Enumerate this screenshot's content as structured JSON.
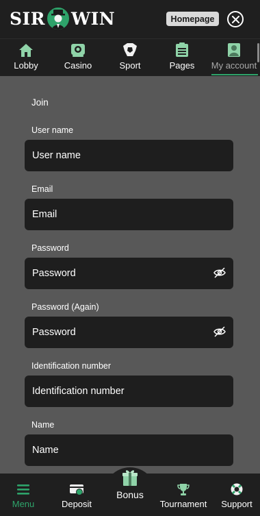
{
  "header": {
    "logo_left": "SIR",
    "logo_right": "WIN",
    "homepage_label": "Homepage"
  },
  "top_nav": [
    {
      "label": "Lobby",
      "icon": "home-icon"
    },
    {
      "label": "Casino",
      "icon": "casino-chip-icon"
    },
    {
      "label": "Sport",
      "icon": "soccer-ball-icon"
    },
    {
      "label": "Pages",
      "icon": "pages-list-icon"
    },
    {
      "label": "My account",
      "icon": "user-icon",
      "active": true
    }
  ],
  "form": {
    "title": "Join",
    "fields": [
      {
        "label": "User name",
        "placeholder": "User name"
      },
      {
        "label": "Email",
        "placeholder": "Email"
      },
      {
        "label": "Password",
        "placeholder": "Password",
        "icon": "eye-hidden-icon"
      },
      {
        "label": "Password (Again)",
        "placeholder": "Password",
        "icon": "eye-hidden-icon"
      },
      {
        "label": "Identification number",
        "placeholder": "Identification number"
      },
      {
        "label": "Name",
        "placeholder": "Name"
      }
    ]
  },
  "bottom_nav": [
    {
      "label": "Menu",
      "icon": "hamburger-menu-icon",
      "active": true
    },
    {
      "label": "Deposit",
      "icon": "deposit-wallet-icon"
    },
    {
      "label": "Bonus",
      "icon": "gift-icon"
    },
    {
      "label": "Tournament",
      "icon": "trophy-icon"
    },
    {
      "label": "Support",
      "icon": "lifebuoy-icon"
    }
  ],
  "colors": {
    "accent": "#2ea36a",
    "active_tab_icon": "#8fd3a8",
    "header_bg": "#1f1f1f",
    "page_bg": "#585858",
    "field_bg": "#1e1e1e"
  }
}
